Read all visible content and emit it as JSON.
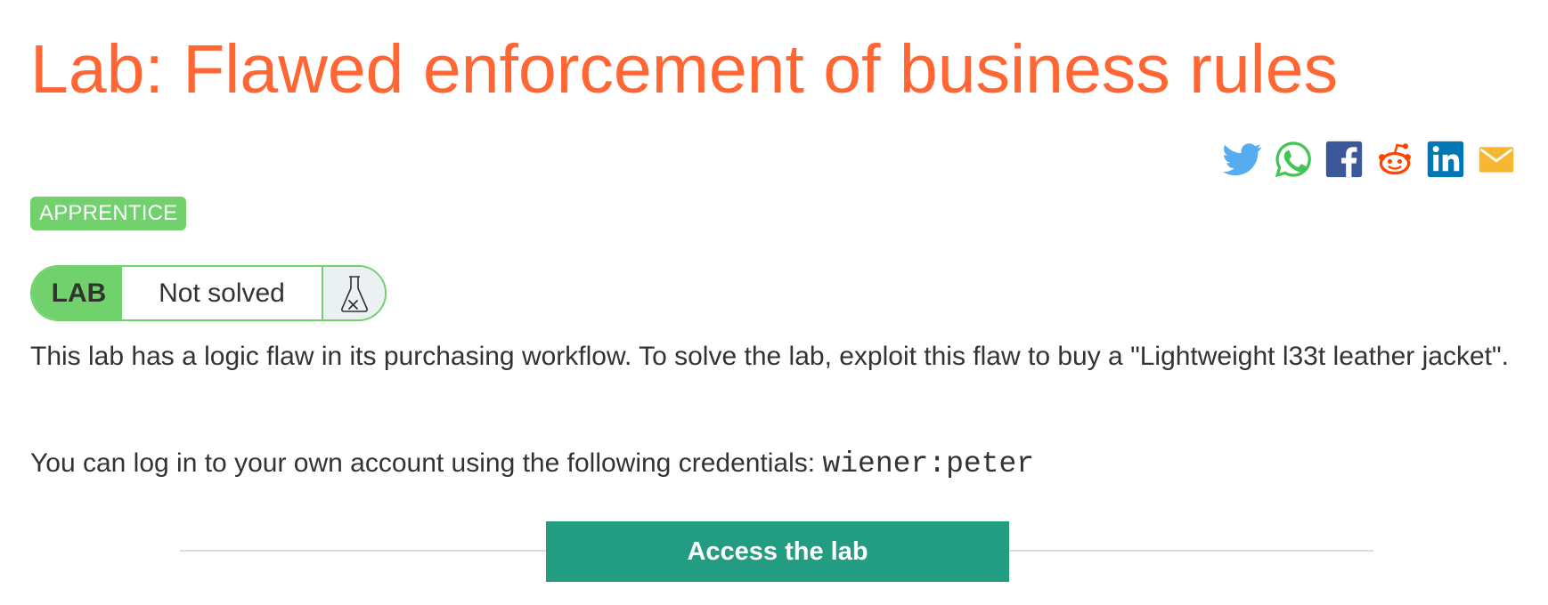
{
  "page": {
    "title": "Lab: Flawed enforcement of business rules",
    "accent_color": "#ff6633"
  },
  "share": {
    "icons": [
      "twitter-icon",
      "whatsapp-icon",
      "facebook-icon",
      "reddit-icon",
      "linkedin-icon",
      "email-icon"
    ],
    "colors": {
      "twitter": "#55acee",
      "whatsapp": "#43c553",
      "facebook": "#3b5998",
      "reddit": "#ff4500",
      "linkedin": "#0077b5",
      "email": "#f7b731"
    }
  },
  "badge": {
    "level": "APPRENTICE",
    "color": "#70d16d"
  },
  "lab_status": {
    "tag": "LAB",
    "status": "Not solved",
    "icon": "flask-not-solved-icon"
  },
  "content": {
    "description": "This lab has a logic flaw in its purchasing workflow. To solve the lab, exploit this flaw to buy a \"Lightweight l33t leather jacket\".",
    "credentials_prefix": "You can log in to your own account using the following credentials: ",
    "credentials": "wiener:peter"
  },
  "actions": {
    "access_label": "Access the lab",
    "access_color": "#229d82"
  }
}
